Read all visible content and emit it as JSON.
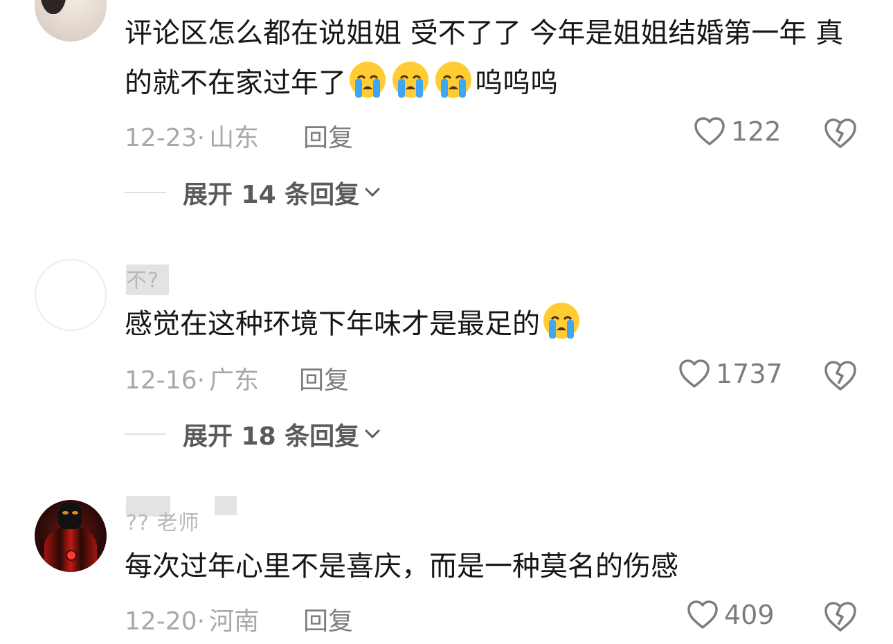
{
  "comments": [
    {
      "username": "",
      "text_part1": "评论区怎么都在说姐姐 受不了了 今年是姐姐结婚第一年 真的就不在家过年了",
      "text_part2": "呜呜呜",
      "emoji": "loudly-crying-face",
      "emoji_count": 3,
      "date": "12-23",
      "separator": "·",
      "location": "山东",
      "reply_label": "回复",
      "likes": "122",
      "expand_label": "展开 14 条回复"
    },
    {
      "username": "不?",
      "text_part1": "感觉在这种环境下年味才是最足的",
      "text_part2": "",
      "emoji": "loudly-crying-face",
      "emoji_count": 1,
      "date": "12-16",
      "separator": "·",
      "location": "广东",
      "reply_label": "回复",
      "likes": "1737",
      "expand_label": "展开 18 条回复"
    },
    {
      "username": "?? 老师",
      "text_part1": "每次过年心里不是喜庆，而是一种莫名的伤感",
      "text_part2": "",
      "emoji": "",
      "emoji_count": 0,
      "date": "12-20",
      "separator": "·",
      "location": "河南",
      "reply_label": "回复",
      "likes": "409",
      "expand_label": ""
    }
  ],
  "icons": {
    "like": "heart-outline-icon",
    "dislike": "broken-heart-icon",
    "expand": "chevron-down-icon",
    "emoji": "loudly-crying-face-icon"
  },
  "colors": {
    "text": "#161616",
    "meta": "#a8a8a8",
    "action": "#7d7d7d",
    "emoji_face": "#ffcc33",
    "emoji_tear": "#3fa5f5"
  }
}
